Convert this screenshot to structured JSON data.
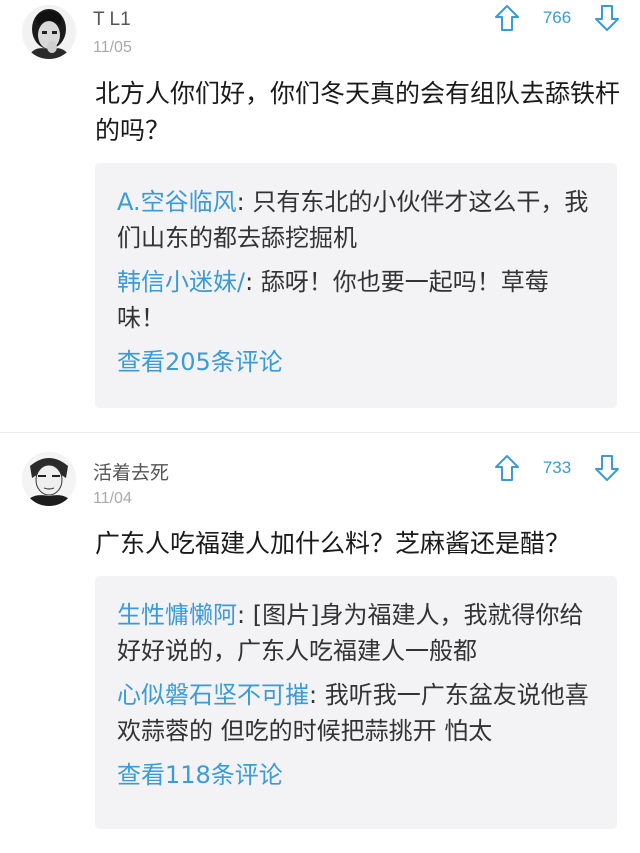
{
  "comments": [
    {
      "username": "T L1",
      "date": "11/05",
      "votes": "766",
      "content": "北方人你们好，你们冬天真的会有组队去舔铁杆的吗？",
      "replies": [
        {
          "name": "A.空谷临风",
          "text": "只有东北的小伙伴才这么干，我们山东的都去舔挖掘机"
        },
        {
          "name": "韩信小迷妹/",
          "text": "舔呀！你也要一起吗！草莓味！"
        }
      ],
      "view_more": "查看205条评论"
    },
    {
      "username": "活着去死",
      "date": "11/04",
      "votes": "733",
      "content": "广东人吃福建人加什么料？芝麻酱还是醋？",
      "replies": [
        {
          "name": "生性慵懒阿",
          "text": "[图片]身为福建人，我就得你给好好说的，广东人吃福建人一般都"
        },
        {
          "name": "心似磐石坚不可摧",
          "text": "我听我一广东盆友说他喜欢蒜蓉的 但吃的时候把蒜挑开 怕太"
        }
      ],
      "view_more": "查看118条评论"
    }
  ],
  "colors": {
    "accent": "#3a9bd8",
    "reply_bg": "#f3f3f5",
    "date": "#a9a9a9"
  },
  "icons": {
    "upvote": "arrow-up-icon",
    "downvote": "arrow-down-icon"
  }
}
